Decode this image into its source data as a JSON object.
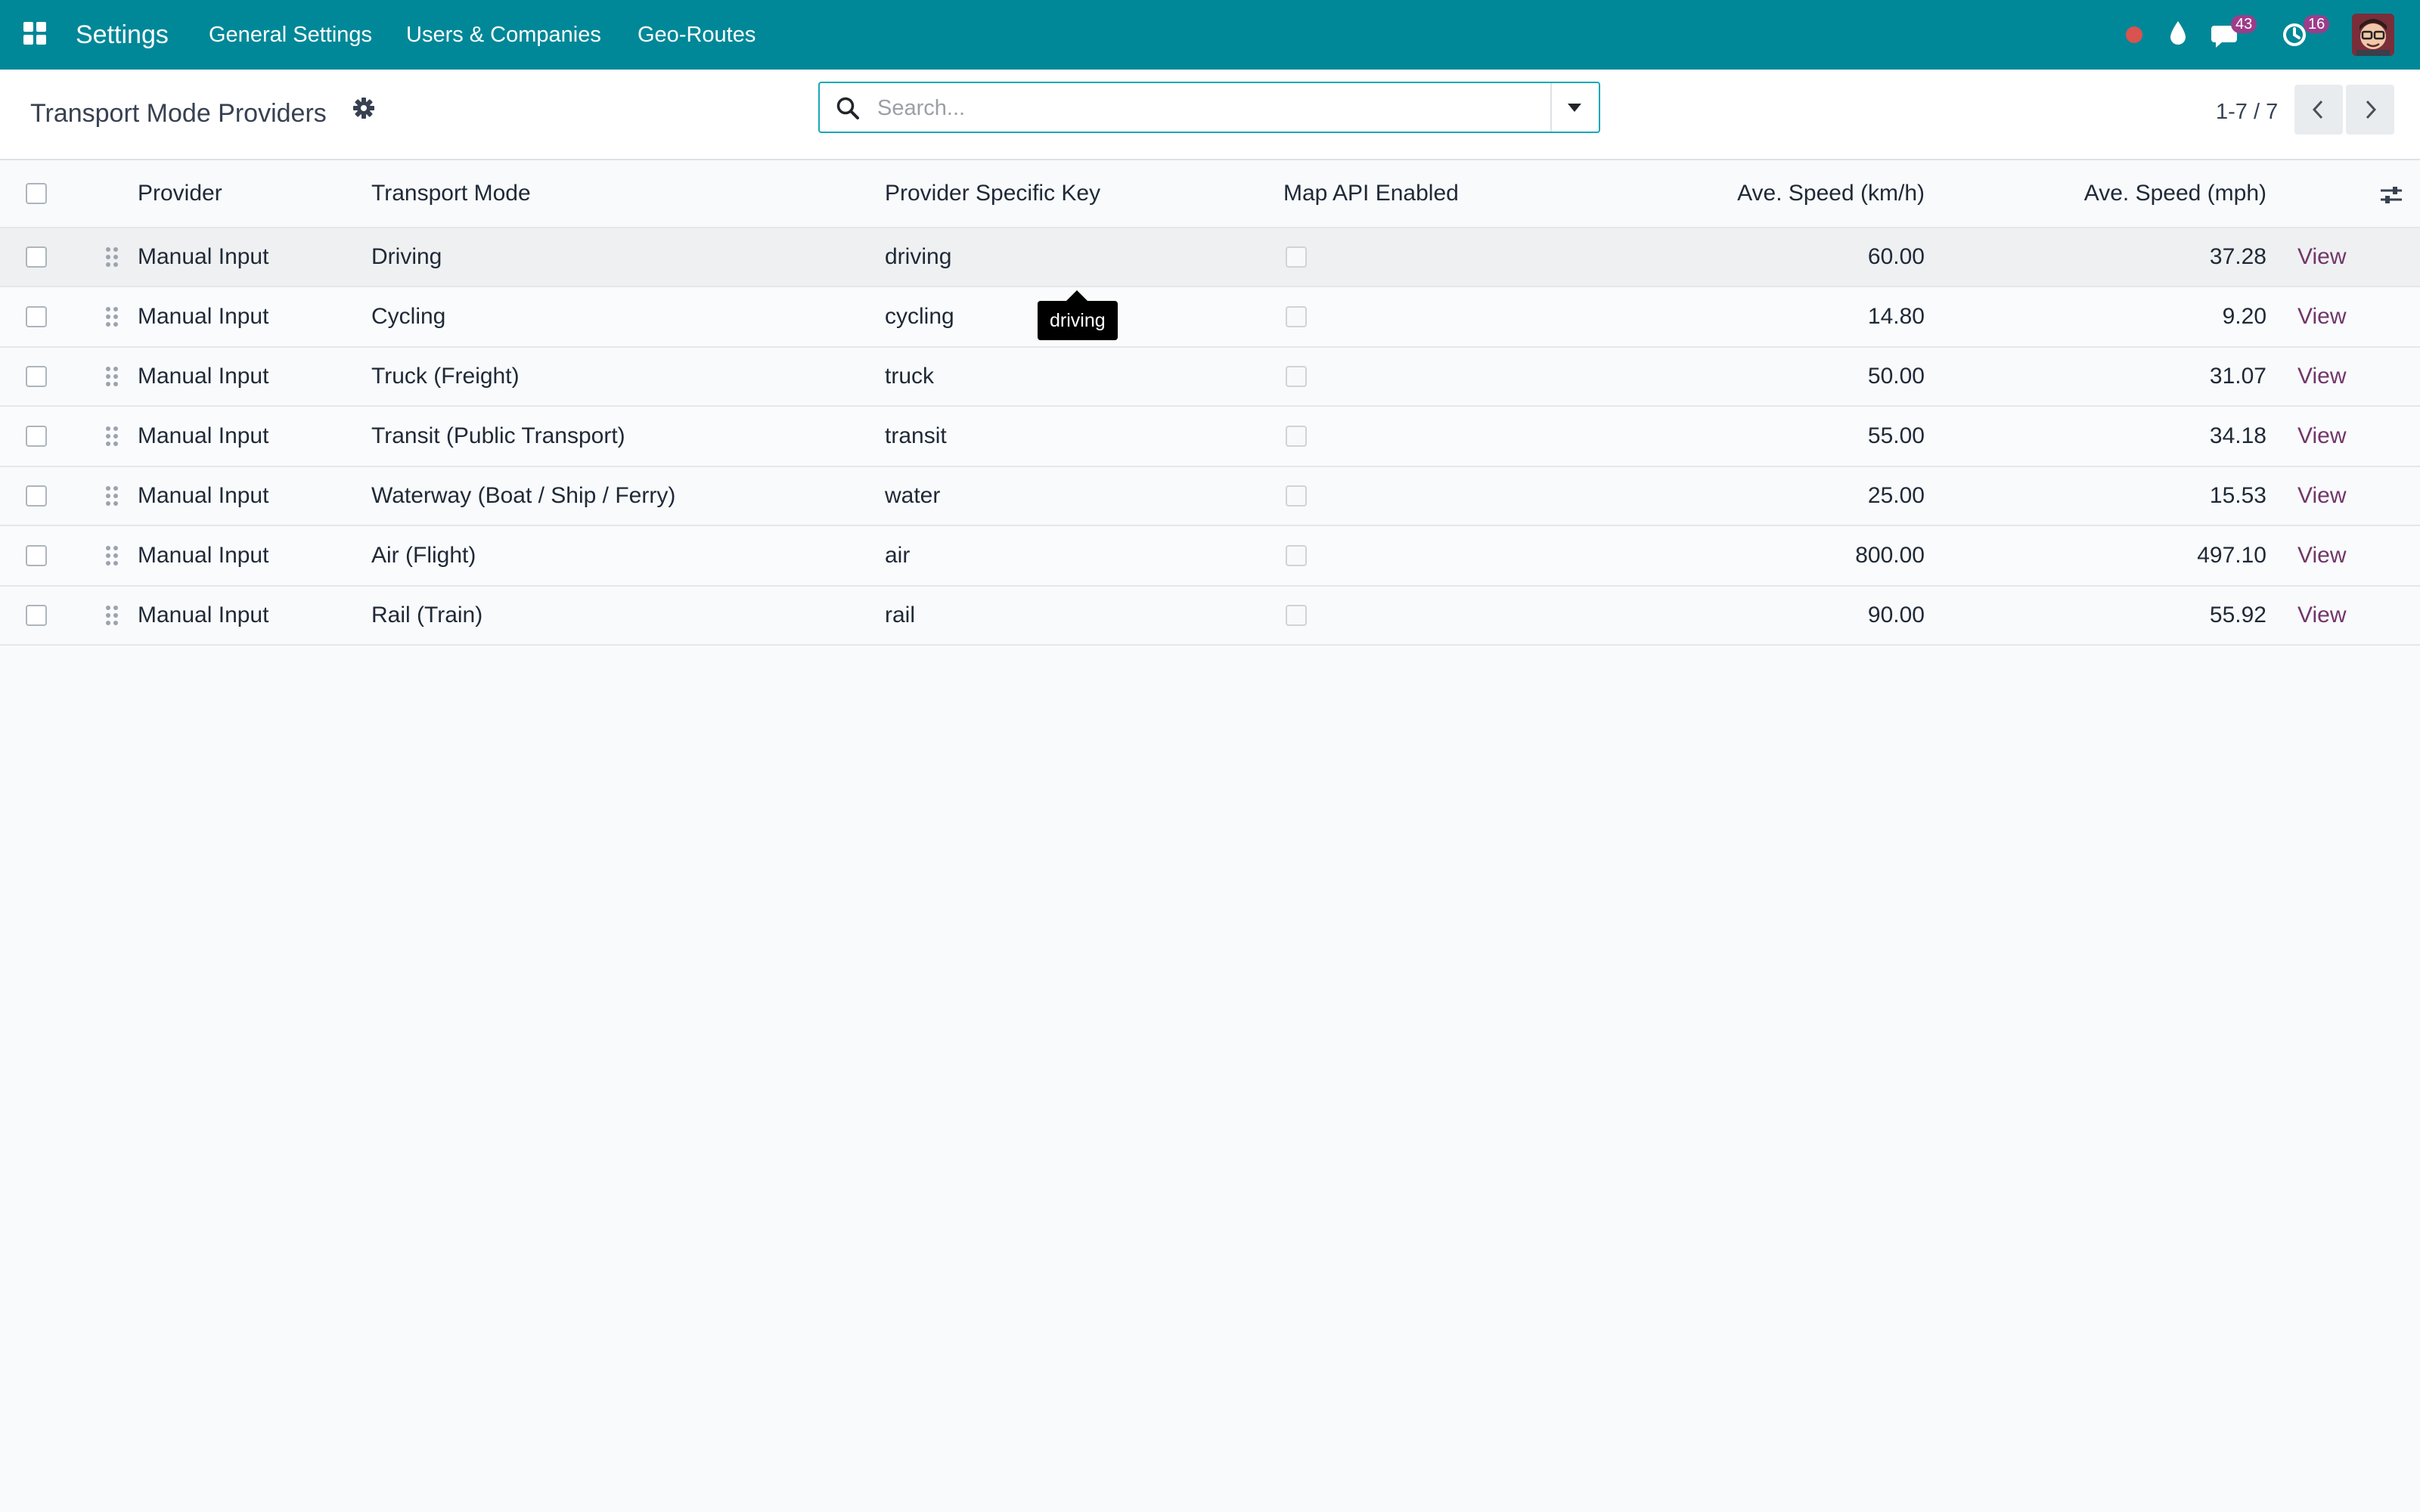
{
  "navbar": {
    "app_title": "Settings",
    "menus": [
      "General Settings",
      "Users & Companies",
      "Geo-Routes"
    ],
    "icons": [
      "apps-grid-icon",
      "recording-dot-icon",
      "droplet-icon",
      "chat-icon",
      "clock-icon"
    ],
    "messages_badge": "43",
    "activities_badge": "16",
    "brand_color": "#008898",
    "badge_color": "#9c3d8a"
  },
  "control_panel": {
    "title": "Transport Mode Providers",
    "search_placeholder": "Search...",
    "pager_value": "1-7 / 7"
  },
  "table": {
    "columns": [
      "Provider",
      "Transport Mode",
      "Provider Specific Key",
      "Map API Enabled",
      "Ave. Speed (km/h)",
      "Ave. Speed (mph)"
    ],
    "rows": [
      {
        "provider": "Manual Input",
        "mode": "Driving",
        "key": "driving",
        "map_api": false,
        "kmh": "60.00",
        "mph": "37.28",
        "action": "View"
      },
      {
        "provider": "Manual Input",
        "mode": "Cycling",
        "key": "cycling",
        "map_api": false,
        "kmh": "14.80",
        "mph": "9.20",
        "action": "View"
      },
      {
        "provider": "Manual Input",
        "mode": "Truck (Freight)",
        "key": "truck",
        "map_api": false,
        "kmh": "50.00",
        "mph": "31.07",
        "action": "View"
      },
      {
        "provider": "Manual Input",
        "mode": "Transit (Public Transport)",
        "key": "transit",
        "map_api": false,
        "kmh": "55.00",
        "mph": "34.18",
        "action": "View"
      },
      {
        "provider": "Manual Input",
        "mode": "Waterway (Boat / Ship / Ferry)",
        "key": "water",
        "map_api": false,
        "kmh": "25.00",
        "mph": "15.53",
        "action": "View"
      },
      {
        "provider": "Manual Input",
        "mode": "Air (Flight)",
        "key": "air",
        "map_api": false,
        "kmh": "800.00",
        "mph": "497.10",
        "action": "View"
      },
      {
        "provider": "Manual Input",
        "mode": "Rail (Train)",
        "key": "rail",
        "map_api": false,
        "kmh": "90.00",
        "mph": "55.92",
        "action": "View"
      }
    ],
    "link_color": "#71366a"
  },
  "tooltip": {
    "text": "driving"
  }
}
